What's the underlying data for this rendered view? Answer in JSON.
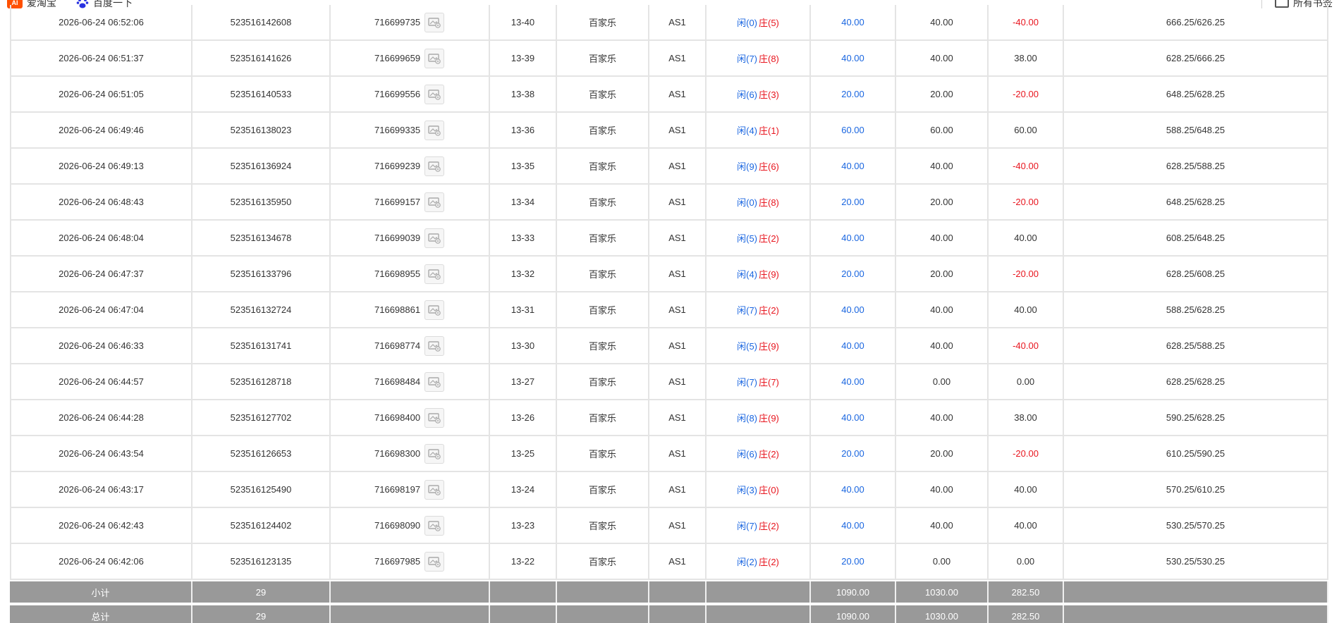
{
  "bookmarks": [
    {
      "label": "爱淘宝",
      "icon": "taobao-icon",
      "icon_text": "AI"
    },
    {
      "label": "百度一下",
      "icon": "baidu-icon"
    },
    {
      "label": "所有书签",
      "icon": "folder-icon"
    }
  ],
  "colors": {
    "blue": "#1a66e0",
    "red": "#e8161f",
    "summary_bg": "#999999"
  },
  "rows": [
    {
      "time": "2026-06-24 06:52:06",
      "order": "523516142608",
      "game_id": "716699735",
      "round": "13-40",
      "type": "百家乐",
      "table": "AS1",
      "player": "闲(0)",
      "banker": "庄(5)",
      "bet": "40.00",
      "valid": "40.00",
      "win": "-40.00",
      "win_color": "red",
      "balance": "666.25/626.25"
    },
    {
      "time": "2026-06-24 06:51:37",
      "order": "523516141626",
      "game_id": "716699659",
      "round": "13-39",
      "type": "百家乐",
      "table": "AS1",
      "player": "闲(7)",
      "banker": "庄(8)",
      "bet": "40.00",
      "valid": "40.00",
      "win": "38.00",
      "win_color": "dark",
      "balance": "628.25/666.25"
    },
    {
      "time": "2026-06-24 06:51:05",
      "order": "523516140533",
      "game_id": "716699556",
      "round": "13-38",
      "type": "百家乐",
      "table": "AS1",
      "player": "闲(6)",
      "banker": "庄(3)",
      "bet": "20.00",
      "valid": "20.00",
      "win": "-20.00",
      "win_color": "red",
      "balance": "648.25/628.25"
    },
    {
      "time": "2026-06-24 06:49:46",
      "order": "523516138023",
      "game_id": "716699335",
      "round": "13-36",
      "type": "百家乐",
      "table": "AS1",
      "player": "闲(4)",
      "banker": "庄(1)",
      "bet": "60.00",
      "valid": "60.00",
      "win": "60.00",
      "win_color": "dark",
      "balance": "588.25/648.25"
    },
    {
      "time": "2026-06-24 06:49:13",
      "order": "523516136924",
      "game_id": "716699239",
      "round": "13-35",
      "type": "百家乐",
      "table": "AS1",
      "player": "闲(9)",
      "banker": "庄(6)",
      "bet": "40.00",
      "valid": "40.00",
      "win": "-40.00",
      "win_color": "red",
      "balance": "628.25/588.25"
    },
    {
      "time": "2026-06-24 06:48:43",
      "order": "523516135950",
      "game_id": "716699157",
      "round": "13-34",
      "type": "百家乐",
      "table": "AS1",
      "player": "闲(0)",
      "banker": "庄(8)",
      "bet": "20.00",
      "valid": "20.00",
      "win": "-20.00",
      "win_color": "red",
      "balance": "648.25/628.25"
    },
    {
      "time": "2026-06-24 06:48:04",
      "order": "523516134678",
      "game_id": "716699039",
      "round": "13-33",
      "type": "百家乐",
      "table": "AS1",
      "player": "闲(5)",
      "banker": "庄(2)",
      "bet": "40.00",
      "valid": "40.00",
      "win": "40.00",
      "win_color": "dark",
      "balance": "608.25/648.25"
    },
    {
      "time": "2026-06-24 06:47:37",
      "order": "523516133796",
      "game_id": "716698955",
      "round": "13-32",
      "type": "百家乐",
      "table": "AS1",
      "player": "闲(4)",
      "banker": "庄(9)",
      "bet": "20.00",
      "valid": "20.00",
      "win": "-20.00",
      "win_color": "red",
      "balance": "628.25/608.25"
    },
    {
      "time": "2026-06-24 06:47:04",
      "order": "523516132724",
      "game_id": "716698861",
      "round": "13-31",
      "type": "百家乐",
      "table": "AS1",
      "player": "闲(7)",
      "banker": "庄(2)",
      "bet": "40.00",
      "valid": "40.00",
      "win": "40.00",
      "win_color": "dark",
      "balance": "588.25/628.25"
    },
    {
      "time": "2026-06-24 06:46:33",
      "order": "523516131741",
      "game_id": "716698774",
      "round": "13-30",
      "type": "百家乐",
      "table": "AS1",
      "player": "闲(5)",
      "banker": "庄(9)",
      "bet": "40.00",
      "valid": "40.00",
      "win": "-40.00",
      "win_color": "red",
      "balance": "628.25/588.25"
    },
    {
      "time": "2026-06-24 06:44:57",
      "order": "523516128718",
      "game_id": "716698484",
      "round": "13-27",
      "type": "百家乐",
      "table": "AS1",
      "player": "闲(7)",
      "banker": "庄(7)",
      "bet": "40.00",
      "valid": "0.00",
      "win": "0.00",
      "win_color": "dark",
      "balance": "628.25/628.25"
    },
    {
      "time": "2026-06-24 06:44:28",
      "order": "523516127702",
      "game_id": "716698400",
      "round": "13-26",
      "type": "百家乐",
      "table": "AS1",
      "player": "闲(8)",
      "banker": "庄(9)",
      "bet": "40.00",
      "valid": "40.00",
      "win": "38.00",
      "win_color": "dark",
      "balance": "590.25/628.25"
    },
    {
      "time": "2026-06-24 06:43:54",
      "order": "523516126653",
      "game_id": "716698300",
      "round": "13-25",
      "type": "百家乐",
      "table": "AS1",
      "player": "闲(6)",
      "banker": "庄(2)",
      "bet": "20.00",
      "valid": "20.00",
      "win": "-20.00",
      "win_color": "red",
      "balance": "610.25/590.25"
    },
    {
      "time": "2026-06-24 06:43:17",
      "order": "523516125490",
      "game_id": "716698197",
      "round": "13-24",
      "type": "百家乐",
      "table": "AS1",
      "player": "闲(3)",
      "banker": "庄(0)",
      "bet": "40.00",
      "valid": "40.00",
      "win": "40.00",
      "win_color": "dark",
      "balance": "570.25/610.25"
    },
    {
      "time": "2026-06-24 06:42:43",
      "order": "523516124402",
      "game_id": "716698090",
      "round": "13-23",
      "type": "百家乐",
      "table": "AS1",
      "player": "闲(7)",
      "banker": "庄(2)",
      "bet": "40.00",
      "valid": "40.00",
      "win": "40.00",
      "win_color": "dark",
      "balance": "530.25/570.25"
    },
    {
      "time": "2026-06-24 06:42:06",
      "order": "523516123135",
      "game_id": "716697985",
      "round": "13-22",
      "type": "百家乐",
      "table": "AS1",
      "player": "闲(2)",
      "banker": "庄(2)",
      "bet": "20.00",
      "valid": "0.00",
      "win": "0.00",
      "win_color": "dark",
      "balance": "530.25/530.25"
    }
  ],
  "subtotal": {
    "label": "小计",
    "count": "29",
    "bet": "1090.00",
    "valid": "1030.00",
    "win": "282.50"
  },
  "total": {
    "label": "总计",
    "count": "29",
    "bet": "1090.00",
    "valid": "1030.00",
    "win": "282.50"
  }
}
